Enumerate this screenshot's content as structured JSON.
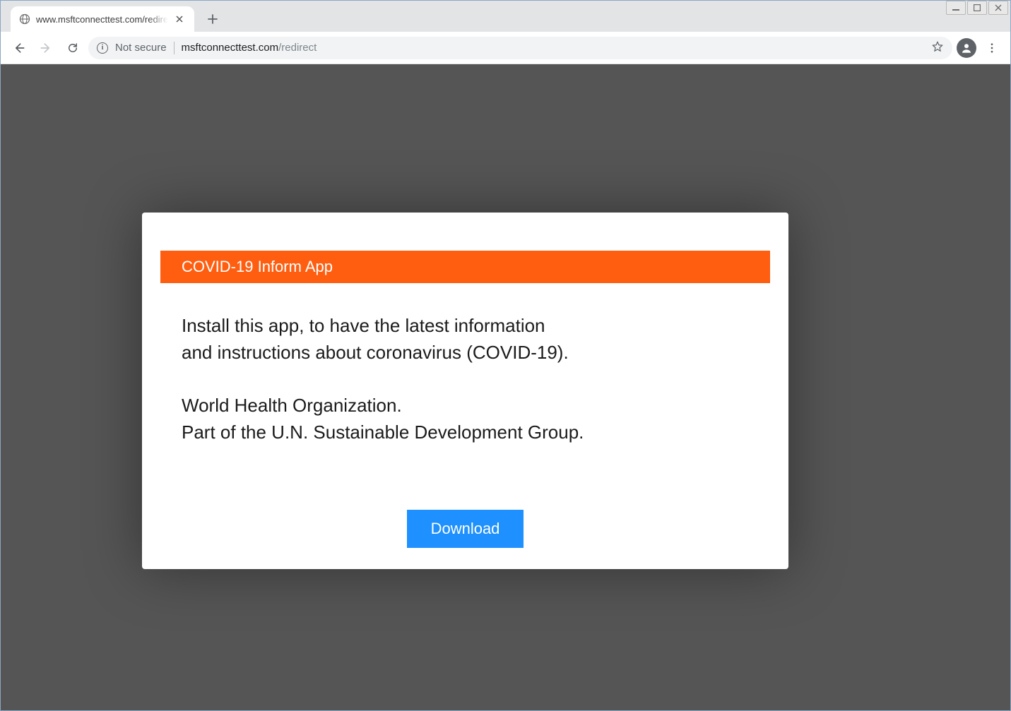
{
  "window": {
    "min_label": "Minimize",
    "max_label": "Maximize",
    "close_label": "Close"
  },
  "tab": {
    "title": "www.msftconnecttest.com/redirect"
  },
  "toolbar": {
    "security_label": "Not secure",
    "url_domain": "msftconnecttest.com",
    "url_path": "/redirect"
  },
  "page": {
    "banner_title": "COVID-19 Inform App",
    "paragraph1": "Install this app, to have the latest information\nand instructions about coronavirus (COVID-19).",
    "paragraph2": "World Health Organization.\nPart of the U.N. Sustainable Development Group.",
    "download_label": "Download"
  },
  "colors": {
    "accent_orange": "#ff5e11",
    "accent_blue": "#1e90ff",
    "viewport_bg": "#555555"
  }
}
